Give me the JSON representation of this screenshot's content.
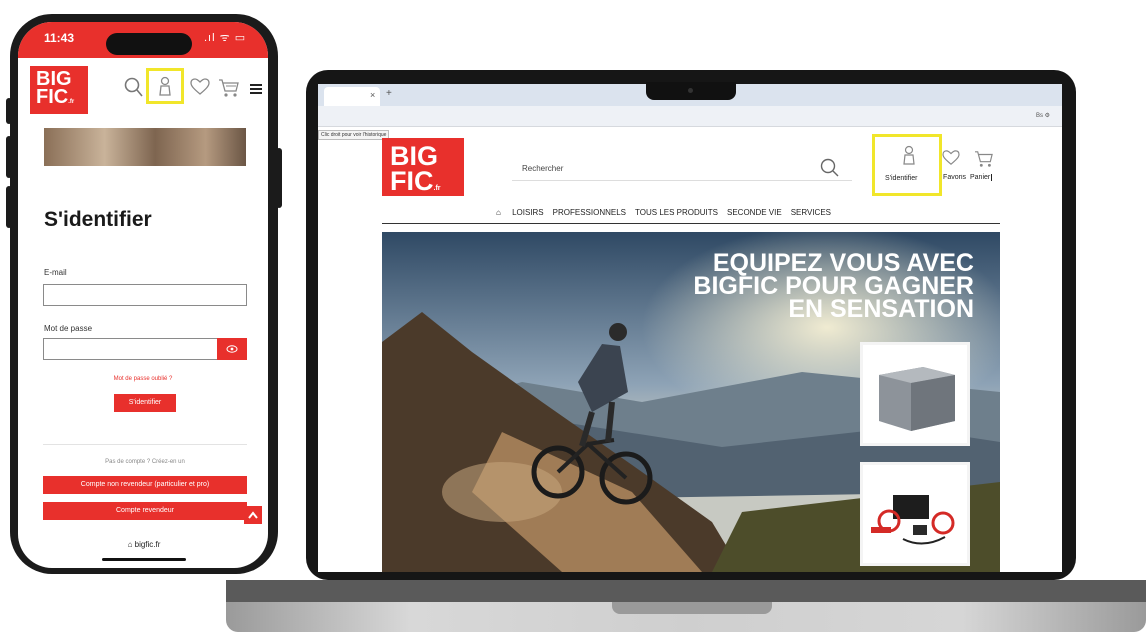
{
  "colors": {
    "brand": "#e8302c",
    "highlight": "#f1e62a"
  },
  "phone": {
    "status": {
      "time": "11:43",
      "signal": ".ıl ᯤ ▭"
    },
    "logo": {
      "line1": "BIG",
      "line2": "FIC",
      "suffix": ".fr"
    },
    "icons": {
      "search": "search-icon",
      "user": "user-icon",
      "heart": "heart-icon",
      "cart": "cart-icon",
      "menu": "menu-icon"
    },
    "login": {
      "title": "S'identifier",
      "email_label": "E-mail",
      "password_label": "Mot de passe",
      "forgot": "Mot de passe oublié ?",
      "submit": "S'identifier",
      "no_account": "Pas de compte ? Créez-en un",
      "btn_non_reseller": "Compte non revendeur (particulier et pro)",
      "btn_reseller": "Compte revendeur"
    },
    "url": "⌂ bigfic.fr"
  },
  "laptop": {
    "tooltip": "Clic droit pour voir l'historique",
    "tab_close": "×",
    "tab_add": "+",
    "search_placeholder": "Rechercher",
    "header_labels": {
      "signin": "S'identifier",
      "favorites": "Favoris",
      "cart": "Panier"
    },
    "nav": [
      "LOISIRS",
      "PROFESSIONNELS",
      "TOUS LES PRODUITS",
      "SECONDE VIE",
      "SERVICES"
    ],
    "hero": {
      "line1": "EQUIPEZ VOUS AVEC",
      "line2": "BIGFIC POUR GAGNER",
      "line3": "EN SENSATION"
    },
    "ext": "Bs ⚙"
  }
}
